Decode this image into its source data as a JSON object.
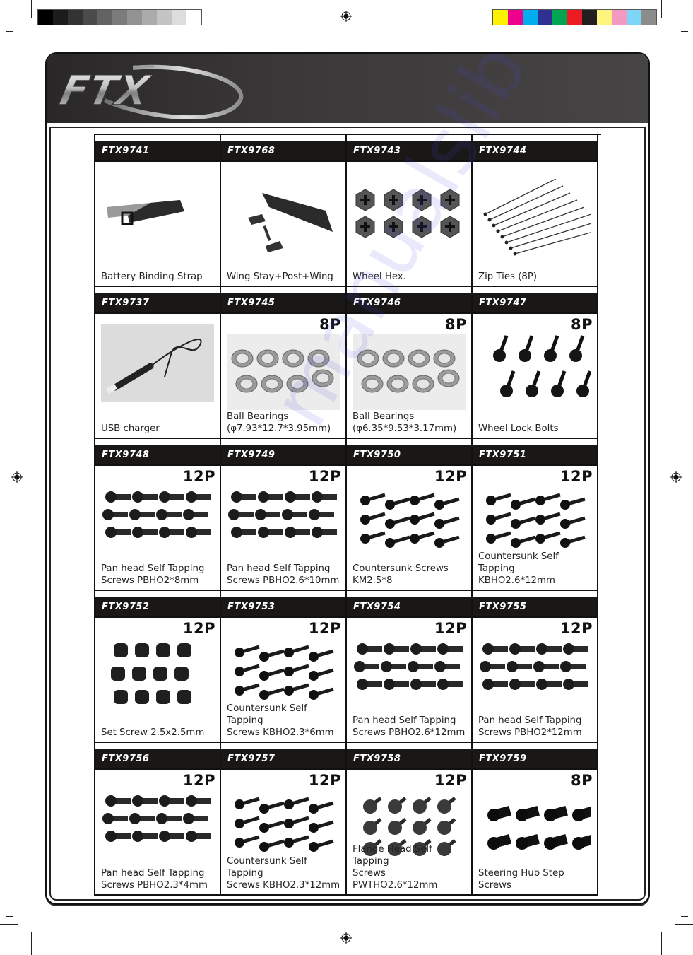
{
  "brand": {
    "logo_text": "FTX"
  },
  "print_marks": {
    "grayscale_swatches": [
      "#000000",
      "#1c1c1c",
      "#333333",
      "#4b4b4b",
      "#636363",
      "#7b7b7b",
      "#939393",
      "#ababab",
      "#c4c4c4",
      "#dddddd",
      "#ffffff"
    ],
    "color_swatches": [
      "#fff200",
      "#ec008c",
      "#00aeef",
      "#2e3192",
      "#00a651",
      "#ed1c24",
      "#231f20",
      "#fff47e",
      "#f49ac1",
      "#7dd6f7",
      "#8c8c8c"
    ]
  },
  "parts": [
    {
      "code": "FTX9741",
      "qty": "",
      "desc": "Battery Binding Strap",
      "icon": "velcro-strap-icon"
    },
    {
      "code": "FTX9768",
      "qty": "",
      "desc": "Wing Stay+Post+Wing",
      "icon": "rear-wing-icon"
    },
    {
      "code": "FTX9743",
      "qty": "",
      "desc": "Wheel Hex.",
      "icon": "wheel-hex-icon"
    },
    {
      "code": "FTX9744",
      "qty": "",
      "desc": "Zip Ties (8P)",
      "icon": "zip-tie-icon"
    },
    {
      "code": "FTX9737",
      "qty": "",
      "desc": "USB charger",
      "icon": "usb-charger-icon"
    },
    {
      "code": "FTX9745",
      "qty": "8P",
      "desc": "Ball Bearings\n(φ7.93*12.7*3.95mm)",
      "icon": "ball-bearing-icon"
    },
    {
      "code": "FTX9746",
      "qty": "8P",
      "desc": "Ball Bearings\n(φ6.35*9.53*3.17mm)",
      "icon": "ball-bearing-icon"
    },
    {
      "code": "FTX9747",
      "qty": "8P",
      "desc": "Wheel Lock Bolts",
      "icon": "flange-bolt-icon"
    },
    {
      "code": "FTX9748",
      "qty": "12P",
      "desc": "Pan head Self Tapping\nScrews PBHO2*8mm",
      "icon": "pan-head-screw-icon"
    },
    {
      "code": "FTX9749",
      "qty": "12P",
      "desc": "Pan head Self Tapping\nScrews PBHO2.6*10mm",
      "icon": "pan-head-screw-icon"
    },
    {
      "code": "FTX9750",
      "qty": "12P",
      "desc": "Countersunk Screws\nKM2.5*8",
      "icon": "countersunk-screw-icon"
    },
    {
      "code": "FTX9751",
      "qty": "12P",
      "desc": "Countersunk Self Tapping\nKBHO2.6*12mm",
      "icon": "countersunk-screw-icon"
    },
    {
      "code": "FTX9752",
      "qty": "12P",
      "desc": "Set Screw 2.5x2.5mm",
      "icon": "set-screw-icon"
    },
    {
      "code": "FTX9753",
      "qty": "12P",
      "desc": "Countersunk Self Tapping\nScrews KBHO2.3*6mm",
      "icon": "countersunk-screw-icon"
    },
    {
      "code": "FTX9754",
      "qty": "12P",
      "desc": "Pan head Self Tapping\nScrews PBHO2.6*12mm",
      "icon": "pan-head-screw-icon"
    },
    {
      "code": "FTX9755",
      "qty": "12P",
      "desc": "Pan head Self Tapping\nScrews PBHO2*12mm",
      "icon": "pan-head-screw-icon"
    },
    {
      "code": "FTX9756",
      "qty": "12P",
      "desc": "Pan head Self Tapping\nScrews PBHO2.3*4mm",
      "icon": "pan-head-screw-icon"
    },
    {
      "code": "FTX9757",
      "qty": "12P",
      "desc": "Countersunk Self Tapping\nScrews KBHO2.3*12mm",
      "icon": "countersunk-screw-icon"
    },
    {
      "code": "FTX9758",
      "qty": "12P",
      "desc": "Flange Head Self Tapping\nScrews PWTHO2.6*12mm",
      "icon": "flange-head-screw-icon"
    },
    {
      "code": "FTX9759",
      "qty": "8P",
      "desc": "Steering Hub Step Screws",
      "icon": "step-screw-icon"
    }
  ]
}
